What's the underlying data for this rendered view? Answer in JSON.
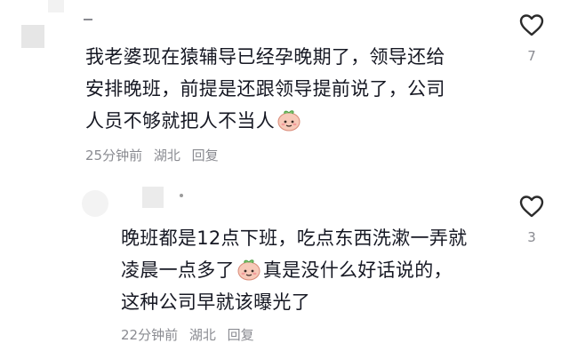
{
  "comments": [
    {
      "text_line1": "我老婆现在猿辅导已经孕晚期了，领导还给",
      "text_line2": "安排晚班，前提是还跟领导提前说了，公司",
      "text_line3": "人员不够就把人不当人",
      "time": "25分钟前",
      "location": "湖北",
      "reply_label": "回复",
      "like_count": "7",
      "emoji": "peach-face-emoji"
    },
    {
      "text_line1": "晚班都是12点下班，吃点东西洗漱一弄就",
      "text_line2_a": "凌晨一点多了",
      "text_line2_b": "真是没什么好话说的，",
      "text_line3": "这种公司早就该曝光了",
      "time": "22分钟前",
      "location": "湖北",
      "reply_label": "回复",
      "like_count": "3",
      "emoji": "peach-face-emoji"
    }
  ],
  "icons": {
    "like": "heart-outline-icon"
  },
  "colors": {
    "text": "#161823",
    "meta": "#8a8b91",
    "emoji_face": "#f7c9b8"
  }
}
